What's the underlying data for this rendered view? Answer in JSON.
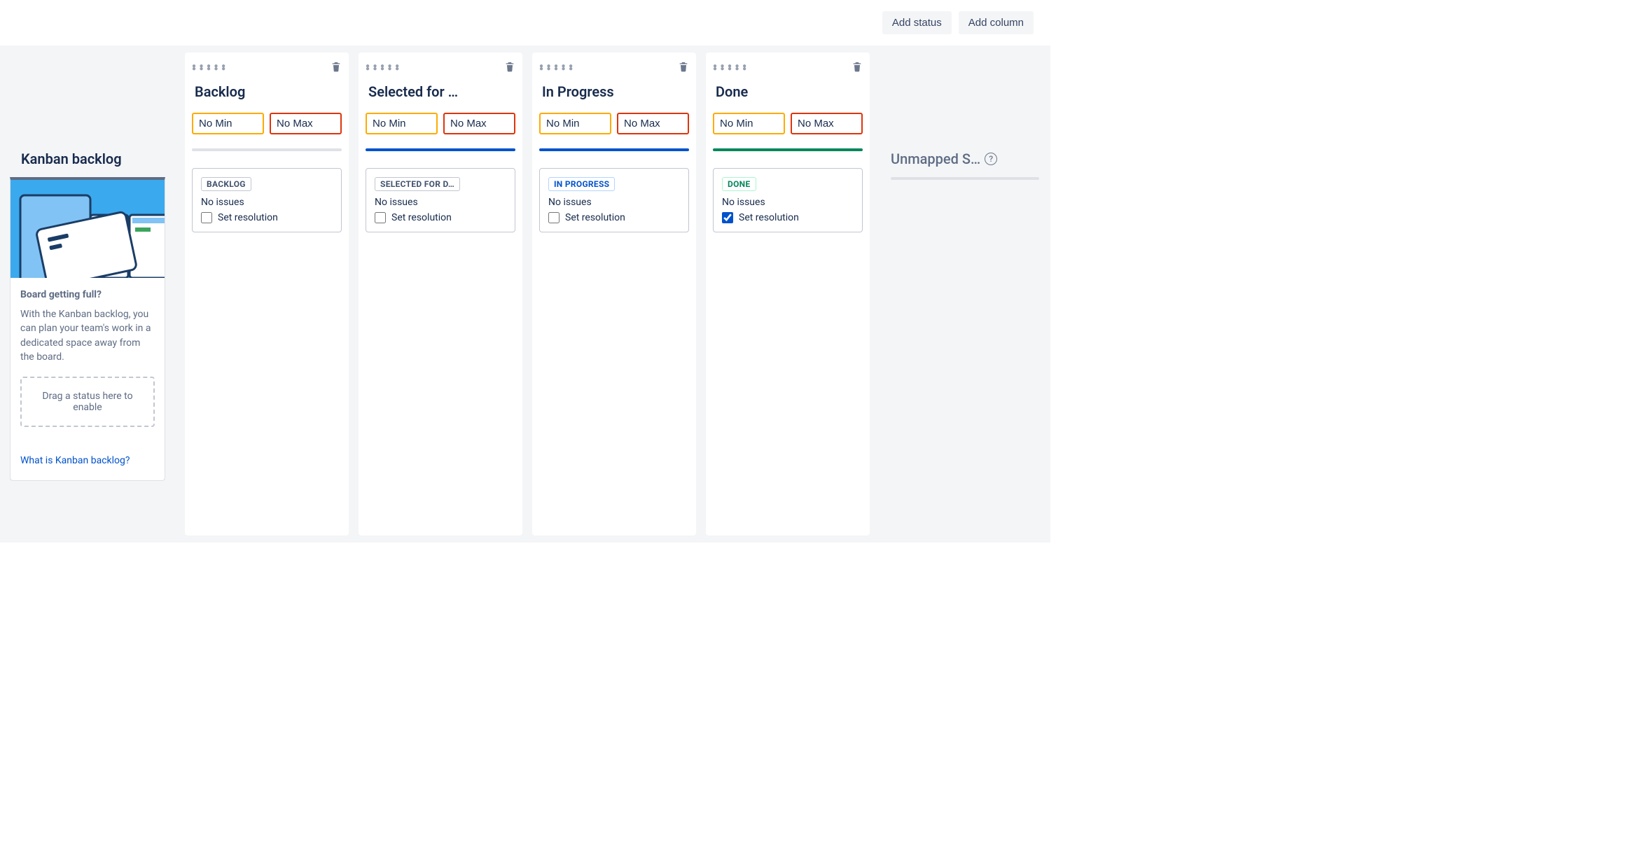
{
  "actions": {
    "add_status": "Add status",
    "add_column": "Add column"
  },
  "kanban_backlog": {
    "title": "Kanban backlog",
    "lead": "Board getting full?",
    "desc": "With the Kanban backlog, you can plan your team's work in a dedicated space away from the board.",
    "dropzone": "Drag a status here to enable",
    "link": "What is Kanban backlog?"
  },
  "limits_labels": {
    "min": "No Min",
    "max": "No Max"
  },
  "set_resolution_label": "Set resolution",
  "no_issues_label": "No issues",
  "columns": [
    {
      "title": "Backlog",
      "divider": "gray",
      "status": {
        "label": "BACKLOG",
        "tone": "gray"
      },
      "set_resolution_checked": false
    },
    {
      "title": "Selected for …",
      "divider": "blue",
      "status": {
        "label": "SELECTED FOR D…",
        "tone": "gray"
      },
      "set_resolution_checked": false
    },
    {
      "title": "In Progress",
      "divider": "blue",
      "status": {
        "label": "IN PROGRESS",
        "tone": "blue"
      },
      "set_resolution_checked": false
    },
    {
      "title": "Done",
      "divider": "green",
      "status": {
        "label": "DONE",
        "tone": "green"
      },
      "set_resolution_checked": true
    }
  ],
  "unmapped": {
    "title": "Unmapped S…"
  }
}
